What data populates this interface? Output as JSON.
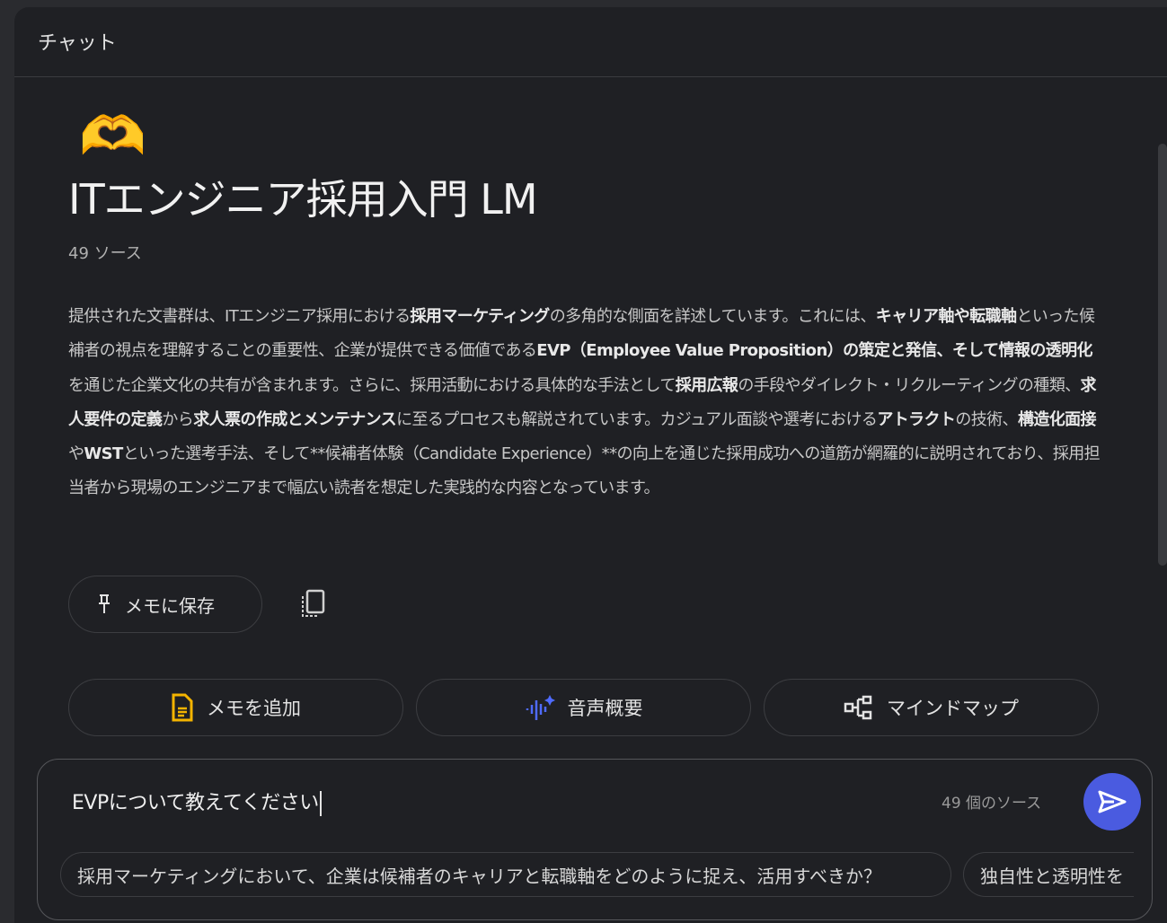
{
  "header": {
    "title": "チャット"
  },
  "notebook": {
    "emoji": "🫶",
    "title": "ITエンジニア採用入門 LM",
    "source_count": "49 ソース",
    "description": [
      {
        "t": "提供された文書群は、ITエンジニア採用における",
        "b": false
      },
      {
        "t": "採用マーケティング",
        "b": true
      },
      {
        "t": "の多角的な側面を詳述しています。これには、",
        "b": false
      },
      {
        "t": "キャリア軸や転職軸",
        "b": true
      },
      {
        "t": "といった候補者の視点を理解することの重要性、企業が提供できる価値である",
        "b": false
      },
      {
        "t": "EVP（Employee Value Proposition）の策定と発信、そして情報の透明化",
        "b": true
      },
      {
        "t": "を通じた企業文化の共有が含まれます。さらに、採用活動における具体的な手法として",
        "b": false
      },
      {
        "t": "採用広報",
        "b": true
      },
      {
        "t": "の手段やダイレクト・リクルーティングの種類、",
        "b": false
      },
      {
        "t": "求人要件の定義",
        "b": true
      },
      {
        "t": "から",
        "b": false
      },
      {
        "t": "求人票の作成とメンテナンス",
        "b": true
      },
      {
        "t": "に至るプロセスも解説されています。カジュアル面談や選考における",
        "b": false
      },
      {
        "t": "アトラクト",
        "b": true
      },
      {
        "t": "の技術、",
        "b": false
      },
      {
        "t": "構造化面接",
        "b": true
      },
      {
        "t": "や",
        "b": false
      },
      {
        "t": "WST",
        "b": true
      },
      {
        "t": "といった選考手法、そして**候補者体験（Candidate Experience）**の向上を通じた採用成功への道筋が網羅的に説明されており、採用担当者から現場のエンジニアまで幅広い読者を想定した実践的な内容となっています。",
        "b": false
      }
    ]
  },
  "buttons": {
    "save_memo": "メモに保存",
    "add_memo": "メモを追加",
    "audio_overview": "音声概要",
    "mind_map": "マインドマップ"
  },
  "composer": {
    "value": "EVPについて教えてください",
    "source_count": "49 個のソース",
    "suggestions": [
      "採用マーケティングにおいて、企業は候補者のキャリアと転職軸をどのように捉え、活用すべきか？",
      "独自性と透明性を"
    ]
  },
  "colors": {
    "accent": "#4a5be0",
    "memo_icon": "#f4b400",
    "audio_icon": "#4f6bff"
  }
}
